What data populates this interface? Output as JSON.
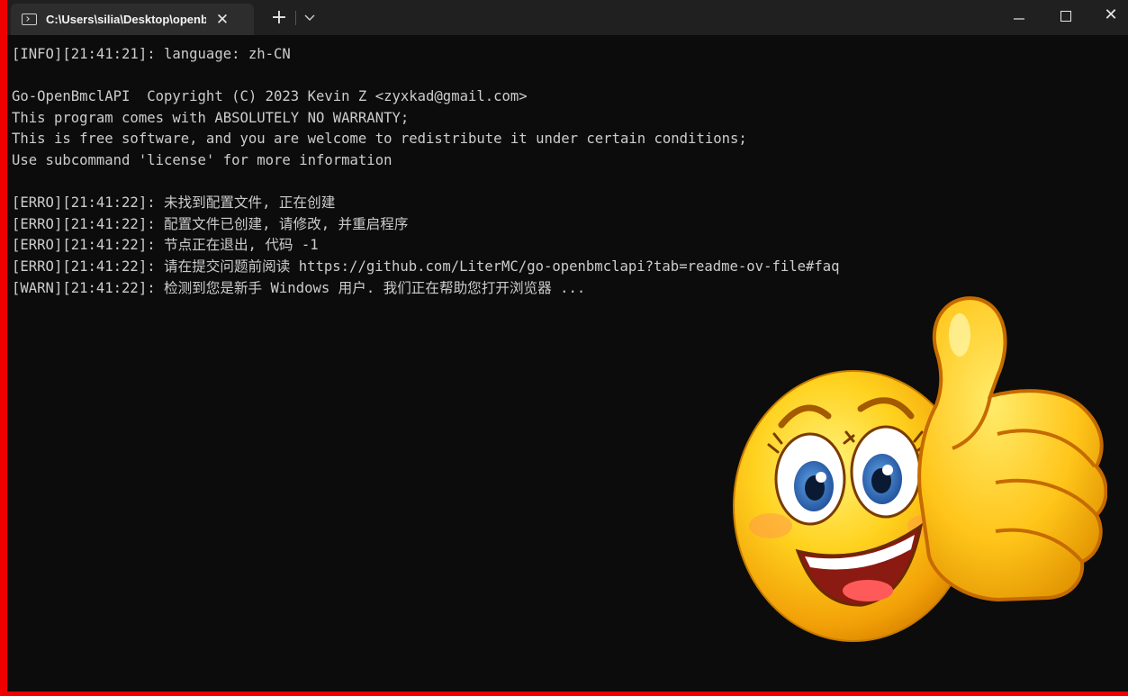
{
  "window": {
    "tab_title": "C:\\Users\\silia\\Desktop\\openbr",
    "tab_close": "✕",
    "new_tab": "+",
    "dropdown": "⌄",
    "minimize": "—",
    "close": "✕"
  },
  "console": {
    "lines": [
      "[INFO][21:41:21]: language: zh-CN",
      "",
      "Go-OpenBmclAPI  Copyright (C) 2023 Kevin Z <zyxkad@gmail.com>",
      "This program comes with ABSOLUTELY NO WARRANTY;",
      "This is free software, and you are welcome to redistribute it under certain conditions;",
      "Use subcommand 'license' for more information",
      "",
      "[ERRO][21:41:22]: 未找到配置文件, 正在创建",
      "[ERRO][21:41:22]: 配置文件已创建, 请修改, 并重启程序",
      "[ERRO][21:41:22]: 节点正在退出, 代码 -1",
      "[ERRO][21:41:22]: 请在提交问题前阅读 https://github.com/LiterMC/go-openbmclapi?tab=readme-ov-file#faq",
      "[WARN][21:41:22]: 检测到您是新手 Windows 用户. 我们正在帮助您打开浏览器 ..."
    ]
  },
  "sticker": {
    "icon": "thumbs-up-smiley-emoji"
  },
  "colors": {
    "border": "#ee0000",
    "titlebar": "#202020",
    "tab": "#2d2d2d",
    "console_bg": "#0c0c0c",
    "console_text": "#cccccc"
  }
}
